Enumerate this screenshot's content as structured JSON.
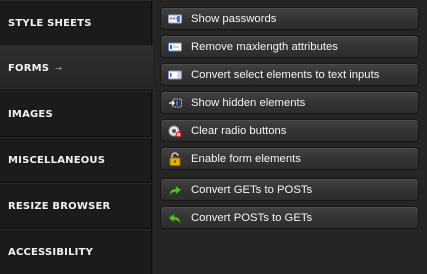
{
  "sidebar": {
    "items": [
      {
        "label": "STYLE SHEETS"
      },
      {
        "label": "FORMS",
        "arrow": "→"
      },
      {
        "label": "IMAGES"
      },
      {
        "label": "MISCELLANEOUS"
      },
      {
        "label": "RESIZE BROWSER"
      },
      {
        "label": "ACCESSIBILITY"
      }
    ],
    "active_index": 1
  },
  "forms": {
    "buttons": [
      {
        "label": "Show passwords",
        "icon": "password-field-icon"
      },
      {
        "label": "Remove maxlength attributes",
        "icon": "text-field-icon"
      },
      {
        "label": "Convert select elements to text inputs",
        "icon": "select-box-icon"
      },
      {
        "label": "Show hidden elements",
        "icon": "show-hidden-icon"
      },
      {
        "label": "Clear radio buttons",
        "icon": "clear-radio-icon"
      },
      {
        "label": "Enable form elements",
        "icon": "unlock-icon"
      },
      {
        "label": "Convert GETs to POSTs",
        "icon": "green-arrow-icon"
      },
      {
        "label": "Convert POSTs to GETs",
        "icon": "green-return-arrow-icon"
      }
    ]
  },
  "colors": {
    "sidebar_bg": "#1b1b1b",
    "content_bg": "#252525",
    "button_text": "#f4f4f4",
    "icon_green": "#5fbf2a",
    "icon_red": "#d02a1e",
    "icon_gold": "#e8b000"
  }
}
